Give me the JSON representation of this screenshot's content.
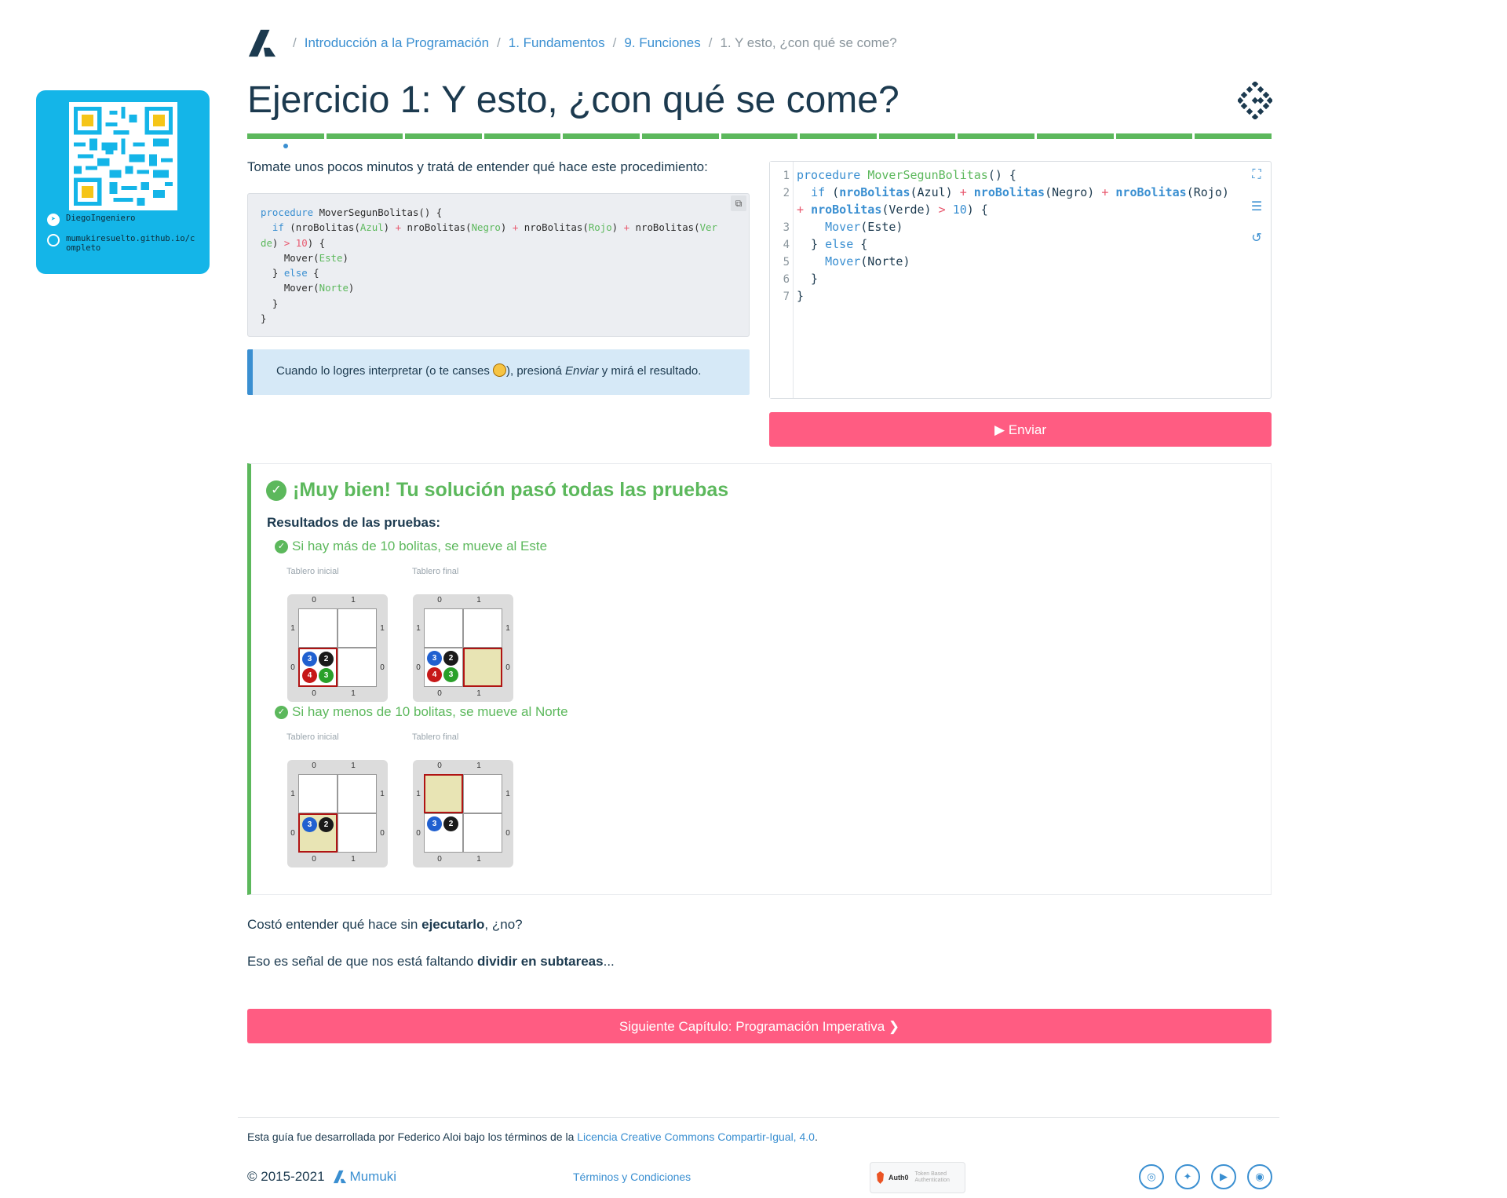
{
  "qr_card": {
    "telegram": "DiegoIngeniero",
    "website": "mumukiresuelto.github.io/completo"
  },
  "breadcrumb": {
    "items": [
      "Introducción a la Programación",
      "1. Fundamentos",
      "9. Funciones"
    ],
    "current": "1. Y esto, ¿con qué se come?"
  },
  "page_title": "Ejercicio 1: Y esto, ¿con qué se come?",
  "progress": {
    "segments": 13,
    "current_index": 1
  },
  "intro": "Tomate unos pocos minutos y tratá de entender qué hace este procedimiento:",
  "info": {
    "before": "Cuando lo logres interpretar (o te canses ",
    "middle": "), presioná ",
    "em": "Enviar",
    "after": " y mirá el resultado."
  },
  "editor": {
    "line_numbers": [
      "1",
      "2",
      "",
      "3",
      "4",
      "5",
      "6",
      "7"
    ]
  },
  "submit_label": "Enviar",
  "results": {
    "title": "¡Muy bien! Tu solución pasó todas las pruebas",
    "subtitle": "Resultados de las pruebas:",
    "board_initial": "Tablero inicial",
    "board_final": "Tablero final",
    "tests": [
      {
        "title": "Si hay más de 10 bolitas, se mueve al Este"
      },
      {
        "title": "Si hay menos de 10 bolitas, se mueve al Norte"
      }
    ],
    "balls": {
      "azul": "3",
      "negro": "2",
      "rojo": "4",
      "verde": "3"
    }
  },
  "para1": {
    "before": "Costó entender qué hace sin ",
    "bold": "ejecutarlo",
    "after": ", ¿no?"
  },
  "para2": {
    "before": "Eso es señal de que nos está faltando ",
    "bold": "dividir en subtareas",
    "after": "..."
  },
  "next_chapter": "Siguiente Capítulo: Programación Imperativa",
  "footer": {
    "license_before": "Esta guía fue desarrollada por Federico Aloi bajo los términos de la ",
    "license_link": "Licencia Creative Commons Compartir-Igual, 4.0",
    "license_after": ".",
    "copyright": "© 2015-2021",
    "brand": "Mumuki",
    "terms": "Términos y Condiciones",
    "auth0": "Auth0",
    "auth0_caption": "Token Based Authentication"
  },
  "colors": {
    "accent": "#3a8fd1",
    "success": "#5cb85c",
    "primary_button": "#ff5c82",
    "qr_card": "#14b5e8"
  }
}
